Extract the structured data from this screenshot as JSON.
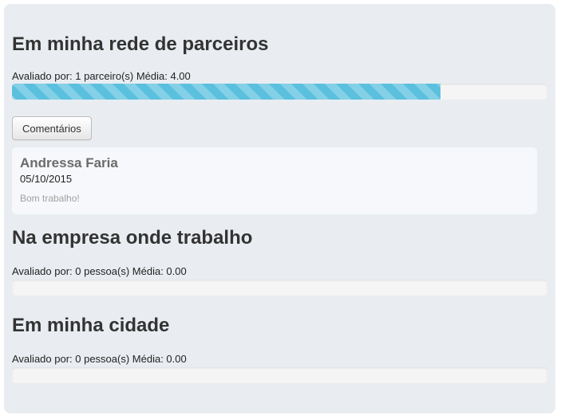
{
  "sections": [
    {
      "title": "Em minha rede de parceiros",
      "stats": "Avaliado por: 1 parceiro(s) Média: 4.00",
      "rating_fraction": 0.8
    },
    {
      "title": "Na empresa onde trabalho",
      "stats": "Avaliado por: 0 pessoa(s) Média: 0.00",
      "rating_fraction": 0
    },
    {
      "title": "Em minha cidade",
      "stats": "Avaliado por: 0 pessoa(s) Média: 0.00",
      "rating_fraction": 0
    }
  ],
  "comments_button_label": "Comentários",
  "comment": {
    "author": "Andressa Faria",
    "date": "05/10/2015",
    "text": "Bom trabalho!"
  },
  "colors": {
    "panel_background": "#e9edf1",
    "progress_fill": "#5bc0de",
    "progress_track": "#f5f5f5"
  }
}
